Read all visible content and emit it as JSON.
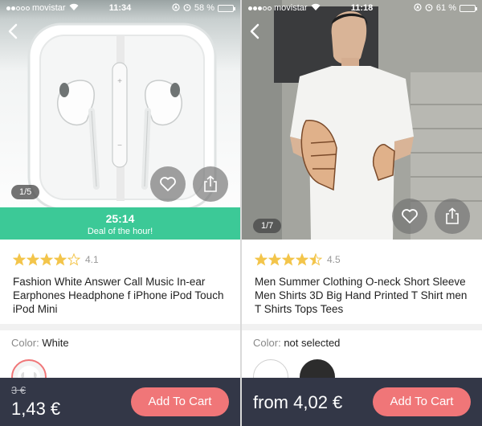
{
  "screens": [
    {
      "status": {
        "carrier": "movistar",
        "time": "11:34",
        "battery": "58 %",
        "battery_level": 0.58
      },
      "image_counter": "1/5",
      "deal": {
        "timer": "25:14",
        "label": "Deal of the hour!"
      },
      "rating": {
        "value": "4.1",
        "stars_filled": 4,
        "stars_total": 5
      },
      "title": "Fashion White Answer Call Music In-ear Earphones Headphone f iPhone iPod Touch iPod Mini",
      "color": {
        "label": "Color:",
        "value": "White"
      },
      "price": {
        "old": "3 €",
        "current": "1,43 €"
      },
      "add_to_cart": "Add To Cart"
    },
    {
      "status": {
        "carrier": "movistar",
        "time": "11:18",
        "battery": "61 %",
        "battery_level": 0.61
      },
      "image_counter": "1/7",
      "rating": {
        "value": "4.5",
        "stars_filled": 4.5,
        "stars_total": 5
      },
      "title": "Men Summer Clothing O-neck Short Sleeve Men Shirts 3D Big Hand Printed T Shirt men T Shirts Tops Tees",
      "color": {
        "label": "Color:",
        "value": "not selected"
      },
      "price": {
        "current": "from 4,02 €"
      },
      "add_to_cart": "Add To Cart"
    }
  ],
  "colors": {
    "deal_green": "#3cc997",
    "cart_button": "#f07678",
    "bottom_bar": "#333747",
    "star": "#f3c54b"
  },
  "icons": [
    "back-arrow-icon",
    "heart-icon",
    "share-icon",
    "alarm-icon",
    "location-icon",
    "wifi-icon",
    "battery-icon",
    "star-icon"
  ]
}
